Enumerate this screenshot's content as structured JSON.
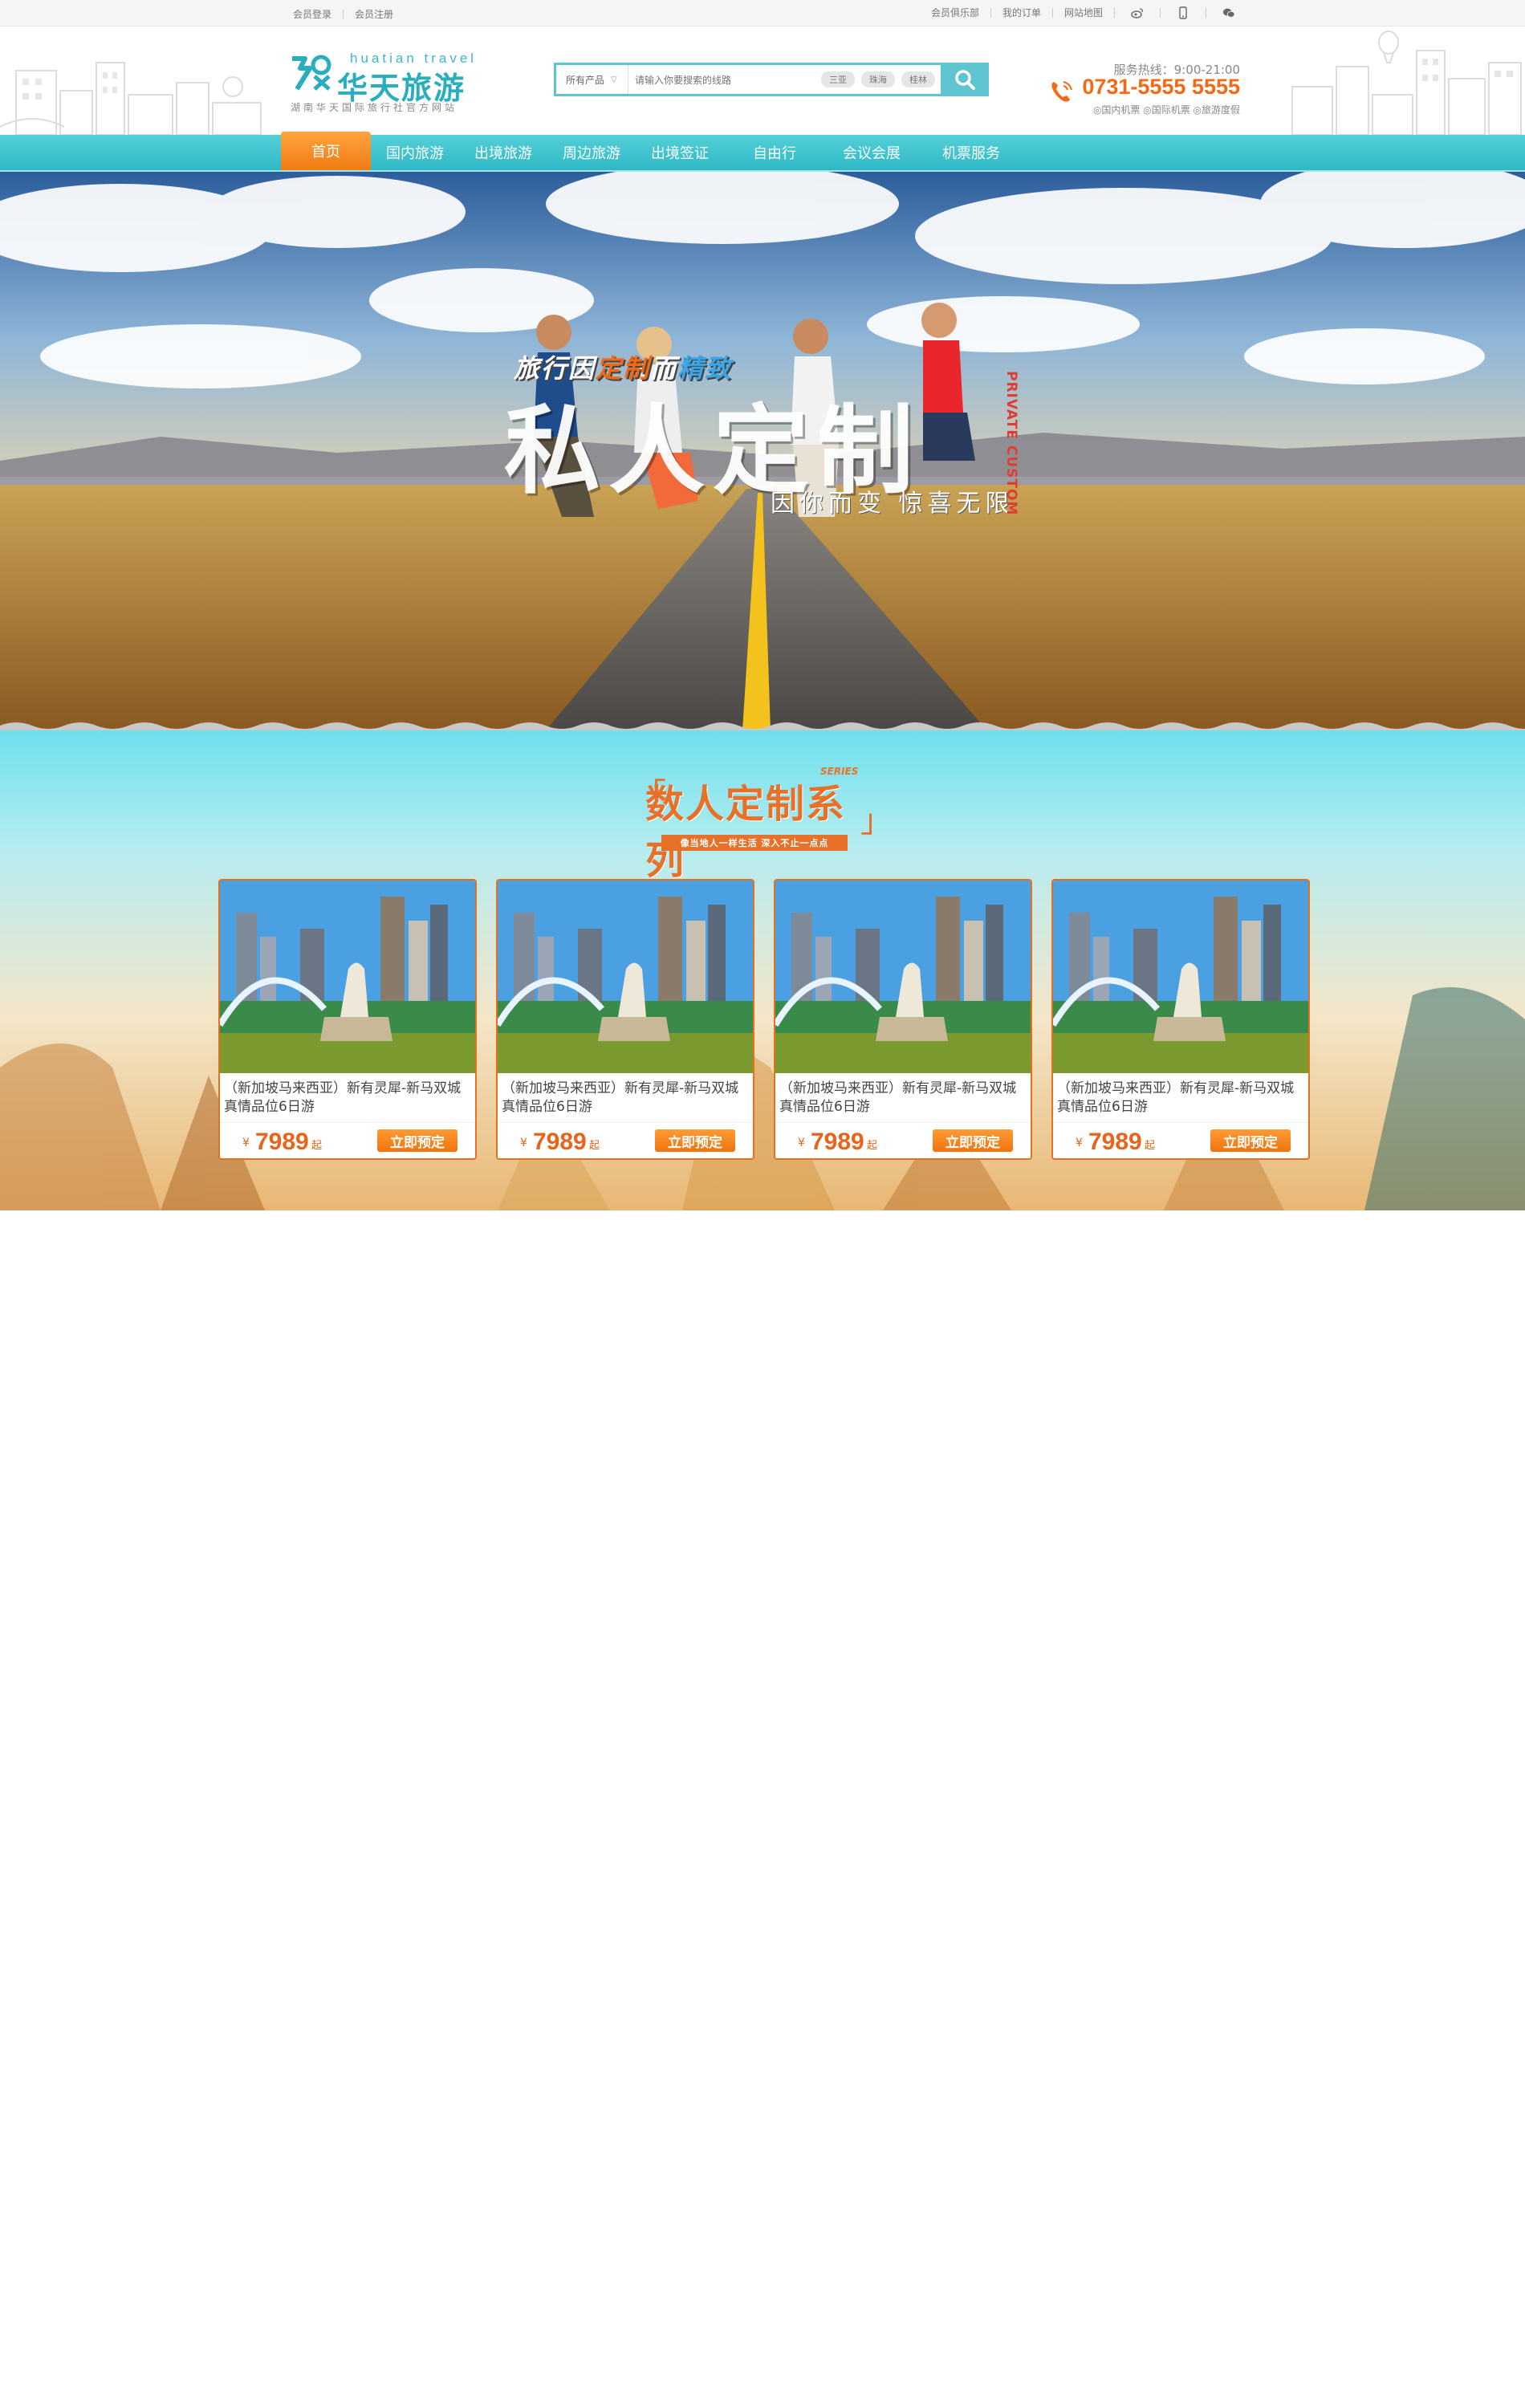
{
  "topbar": {
    "left_links": [
      "会员登录",
      "会员注册"
    ],
    "right_links": [
      "会员俱乐部",
      "我的订单",
      "网站地图"
    ],
    "icons": [
      "weibo-icon",
      "mobile-icon",
      "wechat-icon"
    ]
  },
  "logo": {
    "en": "huatian travel",
    "cn": "华天旅游",
    "sub": "湖南华天国际旅行社官方网站"
  },
  "search": {
    "category": "所有产品",
    "placeholder": "请输入你要搜索的线路",
    "tags": [
      "三亚",
      "珠海",
      "桂林"
    ],
    "button_icon": "search-icon"
  },
  "hotline": {
    "label": "服务热线：9:00-21:00",
    "number": "0731-5555 5555",
    "links": "◎国内机票  ◎国际机票  ◎旅游度假"
  },
  "nav": {
    "items": [
      "首页",
      "国内旅游",
      "出境旅游",
      "周边旅游",
      "出境签证",
      "自由行",
      "会议会展",
      "机票服务"
    ],
    "active_index": 0
  },
  "banner": {
    "slogan_small_a": "旅行",
    "slogan_small_b": "因",
    "slogan_small_c": "定制",
    "slogan_small_d": "而",
    "slogan_small_e": "精致",
    "slogan_big": "私人定制",
    "slogan_sub": "因你而变 惊喜无限",
    "slogan_en": "PRIVATE CUSTOM"
  },
  "section": {
    "title": "数人定制系列",
    "series_tag": "SERIES",
    "subtitle": "像当地人一样生活  深入不止一点点",
    "cards": [
      {
        "name": "（新加坡马来西亚）新有灵犀-新马双城真情品位6日游",
        "currency": "¥",
        "price": "7989",
        "suffix": "起",
        "button": "立即预定"
      },
      {
        "name": "（新加坡马来西亚）新有灵犀-新马双城真情品位6日游",
        "currency": "¥",
        "price": "7989",
        "suffix": "起",
        "button": "立即预定"
      },
      {
        "name": "（新加坡马来西亚）新有灵犀-新马双城真情品位6日游",
        "currency": "¥",
        "price": "7989",
        "suffix": "起",
        "button": "立即预定"
      },
      {
        "name": "（新加坡马来西亚）新有灵犀-新马双城真情品位6日游",
        "currency": "¥",
        "price": "7989",
        "suffix": "起",
        "button": "立即预定"
      }
    ]
  },
  "colors": {
    "brand_teal": "#3db7c7",
    "accent_orange": "#f26a16"
  }
}
